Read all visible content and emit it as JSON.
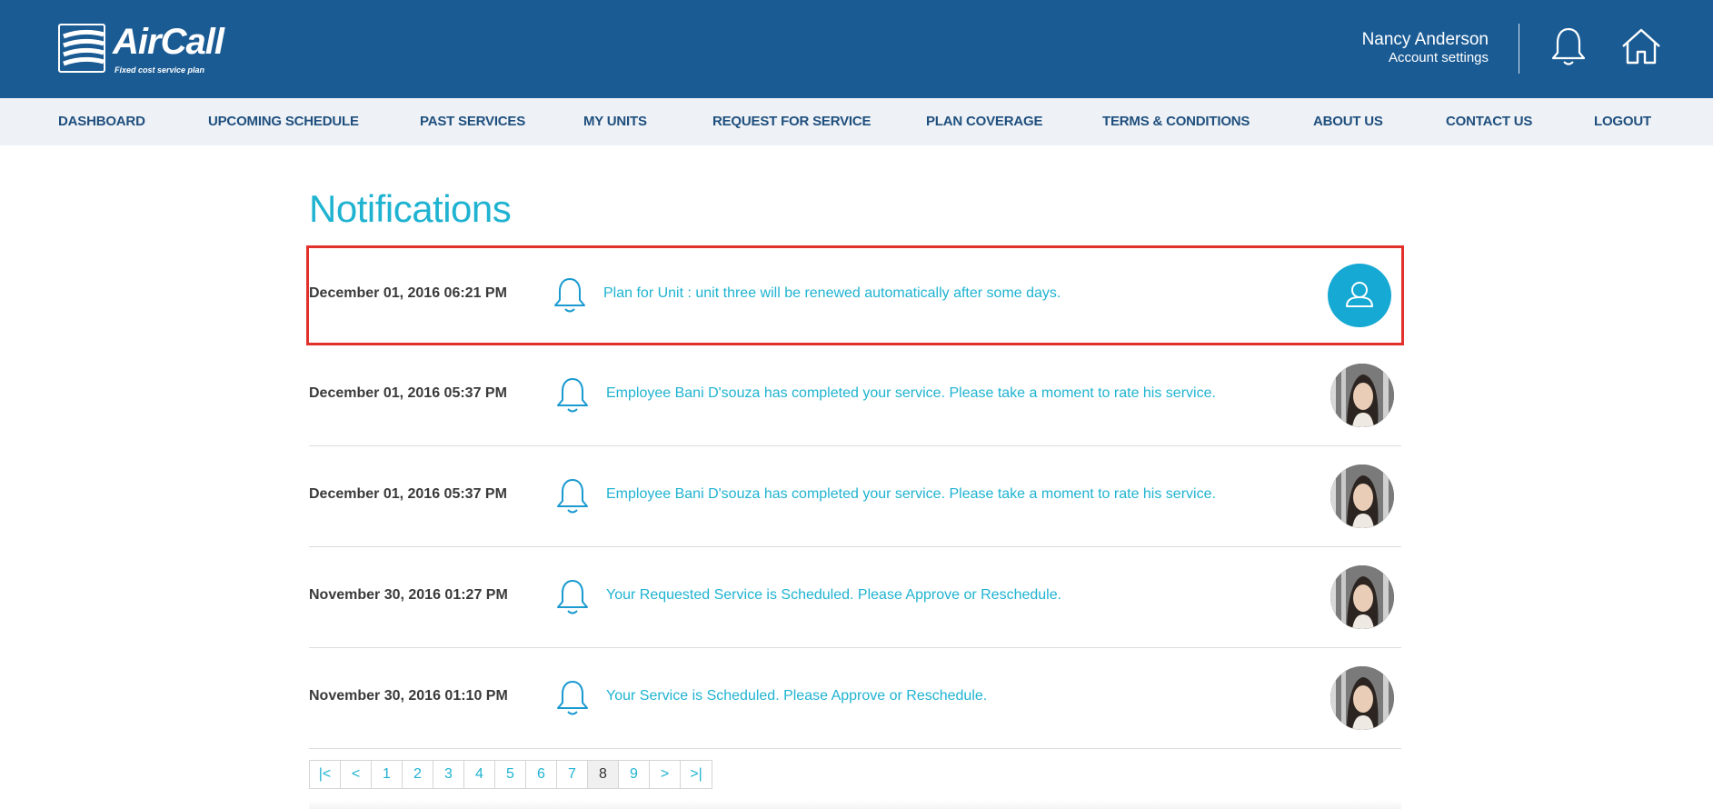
{
  "header": {
    "logo_word": "AirCall",
    "logo_tagline": "Fixed cost service plan",
    "user_name": "Nancy Anderson",
    "account_settings": "Account settings",
    "bell_icon": "bell-icon",
    "home_icon": "home-icon"
  },
  "nav": {
    "items": [
      "DASHBOARD",
      "UPCOMING SCHEDULE",
      "PAST SERVICES",
      "MY UNITS",
      "REQUEST FOR SERVICE",
      "PLAN COVERAGE",
      "TERMS & CONDITIONS",
      "ABOUT US",
      "CONTACT US",
      "LOGOUT"
    ]
  },
  "page": {
    "title": "Notifications"
  },
  "notifications": [
    {
      "date": "December 01, 2016 06:21 PM",
      "message": "Plan for Unit : unit three will be renewed automatically after some days.",
      "avatar": "default-user-icon",
      "highlighted": true
    },
    {
      "date": "December 01, 2016 05:37 PM",
      "message": "Employee Bani D'souza has completed your service. Please take a moment to rate his service.",
      "avatar": "employee-photo"
    },
    {
      "date": "December 01, 2016 05:37 PM",
      "message": "Employee Bani D'souza has completed your service. Please take a moment to rate his service.",
      "avatar": "employee-photo"
    },
    {
      "date": "November 30, 2016 01:27 PM",
      "message": "Your Requested Service is Scheduled. Please Approve or Reschedule.",
      "avatar": "employee-photo"
    },
    {
      "date": "November 30, 2016 01:10 PM",
      "message": "Your Service is Scheduled. Please Approve or Reschedule.",
      "avatar": "employee-photo"
    }
  ],
  "pagination": {
    "items": [
      "|<",
      "<",
      "1",
      "2",
      "3",
      "4",
      "5",
      "6",
      "7",
      "8",
      "9",
      ">",
      ">|"
    ],
    "current": "8"
  },
  "colors": {
    "header_bg": "#1a5b94",
    "nav_bg": "#eef2f6",
    "nav_text": "#1f4f7e",
    "accent": "#1fb3d1",
    "highlight_border": "#e2302a"
  }
}
